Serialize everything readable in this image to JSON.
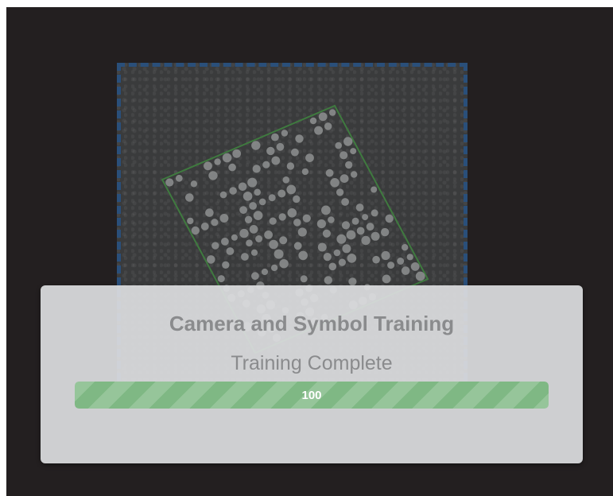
{
  "dialog": {
    "title": "Camera and Symbol Training",
    "status": "Training Complete",
    "progress_value": 100,
    "progress_label": "100",
    "progress_color": "#7fb884"
  },
  "camera_view": {
    "roi_color": "#2a4f7a",
    "symbol_outline_color": "#3f7a3f"
  }
}
